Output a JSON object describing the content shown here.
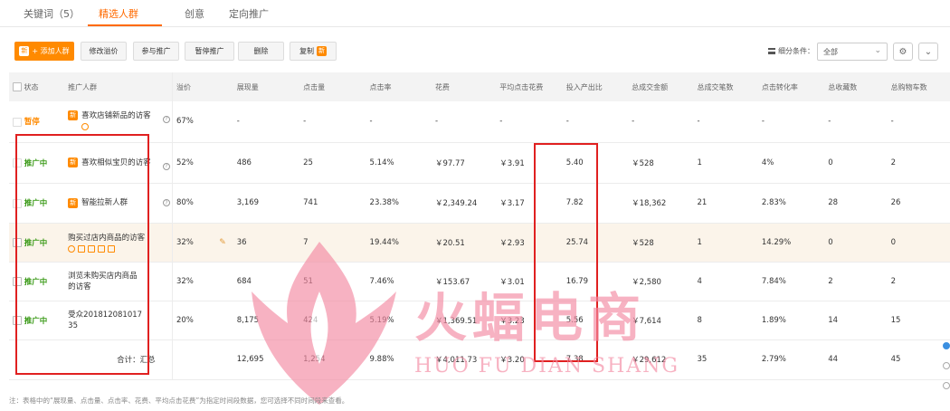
{
  "tabs": [
    {
      "label": "关键词（5）"
    },
    {
      "label": "精选人群"
    },
    {
      "label": "创意"
    },
    {
      "label": "定向推广"
    }
  ],
  "toolbar": {
    "new_badge": "新",
    "add_crowd": "+ 添加人群",
    "modify_premium": "修改溢价",
    "join_promotion": "参与推广",
    "pause_promotion": "暂停推广",
    "delete": "删除",
    "copy": "复制"
  },
  "segment": {
    "label": "细分条件：",
    "selected": "全部",
    "icons": [
      "list-icon",
      "gear-icon",
      "chevron-down-icon"
    ]
  },
  "table": {
    "headers": [
      "状态",
      "推广人群",
      "溢价",
      "展现量",
      "点击量",
      "点击率",
      "花费",
      "平均点击花费",
      "投入产出比",
      "总成交金额",
      "总成交笔数",
      "点击转化率",
      "总收藏数",
      "总购物车数"
    ],
    "rows": [
      {
        "status": "暂停",
        "status_type": "paused",
        "badge": "新",
        "name": "喜欢店铺新品的访客",
        "premium": "67%",
        "impressions": "-",
        "clicks": "-",
        "ctr": "-",
        "cost": "-",
        "cpc": "-",
        "roi": "-",
        "gmv": "-",
        "orders": "-",
        "cvr": "-",
        "favorites": "-",
        "carts": "-"
      },
      {
        "status": "推广中",
        "status_type": "active",
        "badge": "新",
        "name": "喜欢相似宝贝的访客",
        "premium": "52%",
        "impressions": "486",
        "clicks": "25",
        "ctr": "5.14%",
        "cost": "￥97.77",
        "cpc": "￥3.91",
        "roi": "5.40",
        "gmv": "￥528",
        "orders": "1",
        "cvr": "4%",
        "favorites": "0",
        "carts": "2"
      },
      {
        "status": "推广中",
        "status_type": "active",
        "badge": "新",
        "name": "智能拉新人群",
        "premium": "80%",
        "impressions": "3,169",
        "clicks": "741",
        "ctr": "23.38%",
        "cost": "￥2,349.24",
        "cpc": "￥3.17",
        "roi": "7.82",
        "gmv": "￥18,362",
        "orders": "21",
        "cvr": "2.83%",
        "favorites": "28",
        "carts": "26"
      },
      {
        "status": "推广中",
        "status_type": "active",
        "badge": "",
        "name": "购买过店内商品的访客",
        "premium": "32%",
        "impressions": "36",
        "clicks": "7",
        "ctr": "19.44%",
        "cost": "￥20.51",
        "cpc": "￥2.93",
        "roi": "25.74",
        "gmv": "￥528",
        "orders": "1",
        "cvr": "14.29%",
        "favorites": "0",
        "carts": "0"
      },
      {
        "status": "推广中",
        "status_type": "active",
        "badge": "",
        "name": "浏览未购买店内商品的访客",
        "premium": "32%",
        "impressions": "684",
        "clicks": "51",
        "ctr": "7.46%",
        "cost": "￥153.67",
        "cpc": "￥3.01",
        "roi": "16.79",
        "gmv": "￥2,580",
        "orders": "4",
        "cvr": "7.84%",
        "favorites": "2",
        "carts": "2"
      },
      {
        "status": "推广中",
        "status_type": "active",
        "badge": "",
        "name": "受众201812081017 35",
        "premium": "20%",
        "impressions": "8,175",
        "clicks": "424",
        "ctr": "5.19%",
        "cost": "￥1,369.51",
        "cpc": "￥3.23",
        "roi": "5.56",
        "gmv": "￥7,614",
        "orders": "8",
        "cvr": "1.89%",
        "favorites": "14",
        "carts": "15"
      }
    ],
    "total": {
      "label": "合计：汇总",
      "impressions": "12,695",
      "clicks": "1,254",
      "ctr": "9.88%",
      "cost": "￥4,011.73",
      "cpc": "￥3.20",
      "roi": "7.38",
      "gmv": "￥29,612",
      "orders": "35",
      "cvr": "2.79%",
      "favorites": "44",
      "carts": "45"
    }
  },
  "watermark": {
    "cn": "火蝠电商",
    "en": "HUO FU DIAN SHANG"
  },
  "note": "注：表格中的“展现量、点击量、点击率、花费、平均点击花费”为指定时间段数据，您可选择不同时间段来查看。",
  "colors": {
    "accent": "#ff6a00",
    "active": "#3a9a17",
    "annotation": "#e02020",
    "watermark": "#f48aa2"
  }
}
